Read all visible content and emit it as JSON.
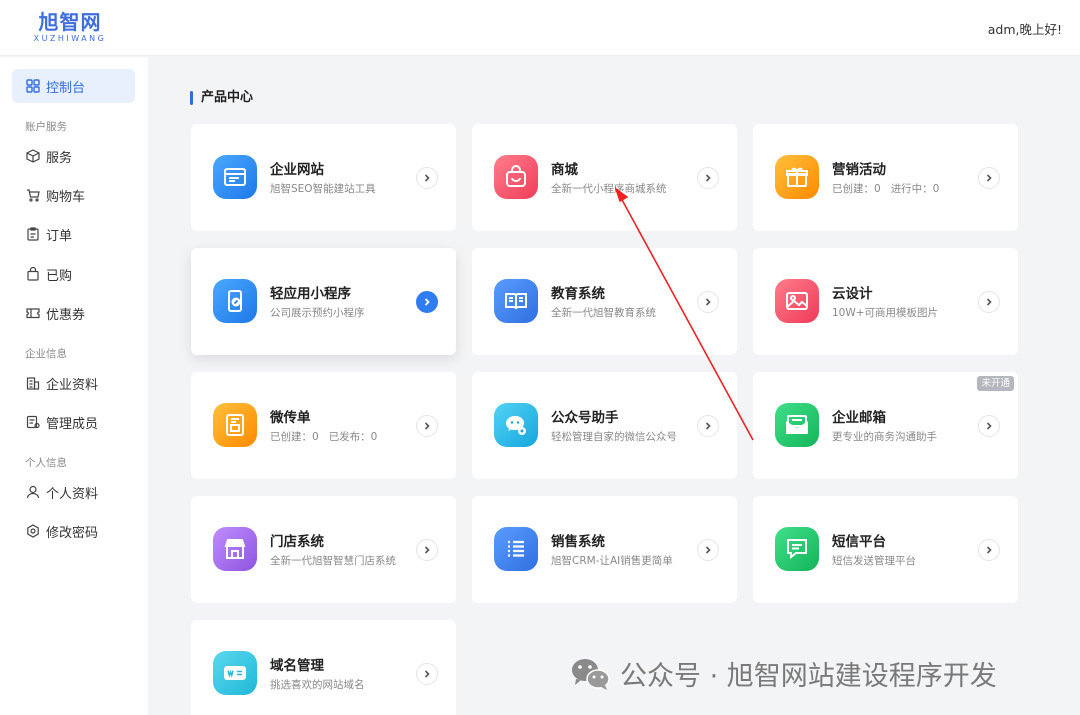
{
  "header": {
    "logo_main": "旭智网",
    "logo_sub": "XUZHIWANG",
    "greeting": "adm,晚上好!"
  },
  "sidebar": {
    "dashboard": "控制台",
    "section_account": "账户服务",
    "service": "服务",
    "cart": "购物车",
    "orders": "订单",
    "purchased": "已购",
    "coupons": "优惠券",
    "section_company": "企业信息",
    "company_profile": "企业资料",
    "members": "管理成员",
    "section_personal": "个人信息",
    "personal_profile": "个人资料",
    "password": "修改密码"
  },
  "main": {
    "section_title": "产品中心",
    "cards": {
      "website": {
        "title": "企业网站",
        "desc": "旭智SEO智能建站工具",
        "icon": "browser-icon",
        "color": "#2d8cf0"
      },
      "mall": {
        "title": "商城",
        "desc": "全新一代小程序商城系统",
        "icon": "shopping-bag-icon",
        "color": "#f5566d"
      },
      "marketing": {
        "title": "营销活动",
        "desc_a": "已创建：0",
        "desc_b": "进行中：0",
        "icon": "gift-icon",
        "color": "#ff9a13"
      },
      "miniapp": {
        "title": "轻应用小程序",
        "desc": "公司展示预约小程序",
        "icon": "phone-link-icon",
        "color": "#2d8cf0"
      },
      "education": {
        "title": "教育系统",
        "desc": "全新一代旭智教育系统",
        "icon": "book-icon",
        "color": "#3a86f2"
      },
      "design": {
        "title": "云设计",
        "desc": "10W+可商用模板图片",
        "icon": "image-icon",
        "color": "#f2506a"
      },
      "weidan": {
        "title": "微传单",
        "desc_a": "已创建：0",
        "desc_b": "已发布：0",
        "icon": "flyer-icon",
        "color": "#ff9a13"
      },
      "official": {
        "title": "公众号助手",
        "desc": "轻松管理自家的微信公众号",
        "icon": "wechat-gear-icon",
        "color": "#22b8e8"
      },
      "email": {
        "title": "企业邮箱",
        "desc": "更专业的商务沟通助手",
        "badge": "未开通",
        "icon": "mail-icon",
        "color": "#1fc265"
      },
      "store": {
        "title": "门店系统",
        "desc": "全新一代旭智智慧门店系统",
        "icon": "store-icon",
        "color": "#a46de8"
      },
      "sales": {
        "title": "销售系统",
        "desc": "旭智CRM-让AI销售更简单",
        "icon": "list-icon",
        "color": "#3a86f2"
      },
      "sms": {
        "title": "短信平台",
        "desc": "短信发送管理平台",
        "icon": "message-icon",
        "color": "#1fc265"
      },
      "domain": {
        "title": "域名管理",
        "desc": "挑选喜欢的网站域名",
        "icon": "domain-icon",
        "color": "#22c3e0"
      }
    }
  },
  "watermark": {
    "text": "公众号 · 旭智网站建设程序开发"
  }
}
